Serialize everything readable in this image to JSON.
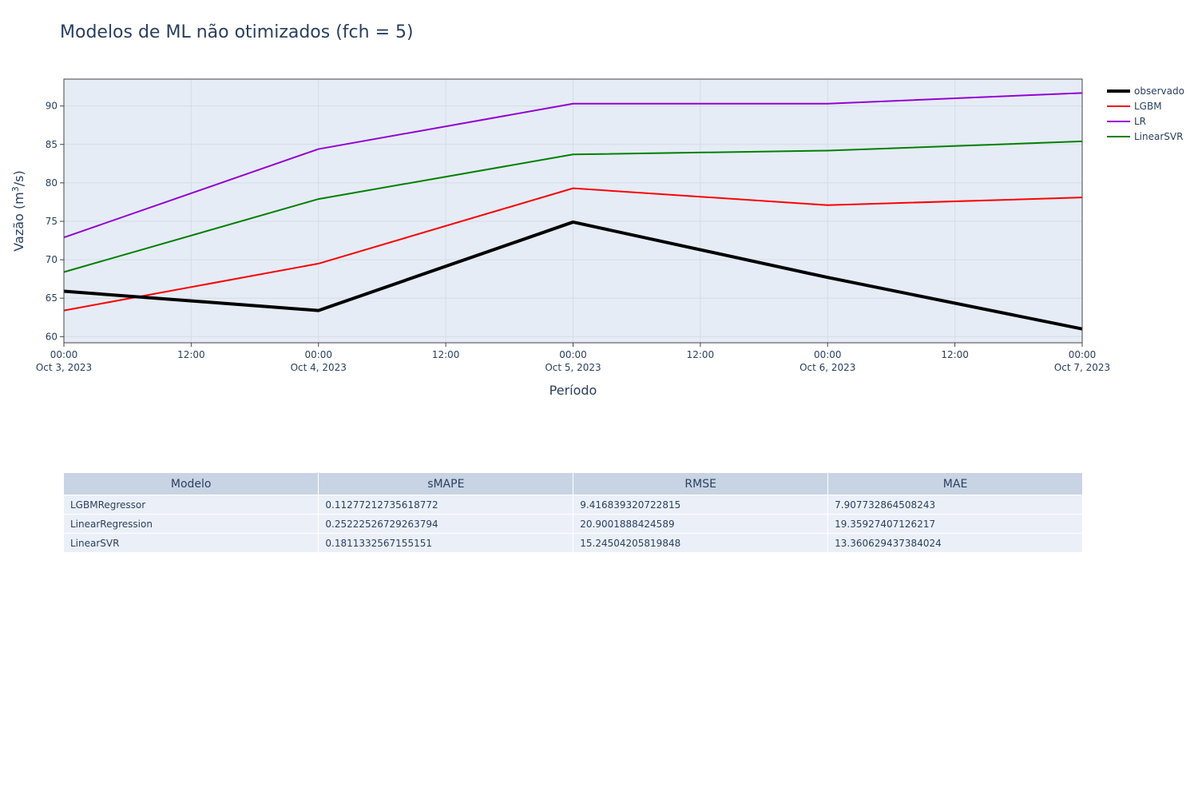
{
  "chart_data": {
    "type": "line",
    "title": "Modelos de ML não otimizados (fch = 5)",
    "xlabel": "Período",
    "ylabel_main": "Vazão (m",
    "ylabel_sup": "3",
    "ylabel_end": "/s)",
    "x": [
      "2023-10-03",
      "2023-10-04",
      "2023-10-05",
      "2023-10-06",
      "2023-10-07"
    ],
    "xlim": [
      "2023-10-03 00:00",
      "2023-10-07 00:00"
    ],
    "ylim": [
      59.2,
      93.5
    ],
    "yticks": [
      60,
      65,
      70,
      75,
      80,
      85,
      90
    ],
    "xtick_labels": [
      {
        "time": "00:00",
        "date": "Oct 3, 2023"
      },
      {
        "time": "12:00",
        "date": ""
      },
      {
        "time": "00:00",
        "date": "Oct 4, 2023"
      },
      {
        "time": "12:00",
        "date": ""
      },
      {
        "time": "00:00",
        "date": "Oct 5, 2023"
      },
      {
        "time": "12:00",
        "date": ""
      },
      {
        "time": "00:00",
        "date": "Oct 6, 2023"
      },
      {
        "time": "12:00",
        "date": ""
      },
      {
        "time": "00:00",
        "date": "Oct 7, 2023"
      }
    ],
    "grid": true,
    "legend_position": "top-right outside",
    "series": [
      {
        "name": "observado",
        "color": "#000000",
        "width": 4,
        "values": [
          65.9,
          63.4,
          74.9,
          67.7,
          61.0
        ]
      },
      {
        "name": "LGBM",
        "color": "#ff0000",
        "width": 2,
        "values": [
          63.4,
          69.5,
          79.3,
          77.1,
          78.1
        ]
      },
      {
        "name": "LR",
        "color": "#9400d3",
        "width": 2,
        "values": [
          72.9,
          84.4,
          90.3,
          90.3,
          91.7
        ]
      },
      {
        "name": "LinearSVR",
        "color": "#008000",
        "width": 2,
        "values": [
          68.4,
          77.9,
          83.7,
          84.2,
          85.4
        ]
      }
    ]
  },
  "table": {
    "headers": [
      "Modelo",
      "sMAPE",
      "RMSE",
      "MAE"
    ],
    "rows": [
      [
        "LGBMRegressor",
        "0.11277212735618772",
        "9.416839320722815",
        "7.907732864508243"
      ],
      [
        "LinearRegression",
        "0.25222526729263794",
        "20.9001888424589",
        "19.35927407126217"
      ],
      [
        "LinearSVR",
        "0.1811332567155151",
        "15.24504205819848",
        "13.360629437384024"
      ]
    ]
  },
  "colors": {
    "plot_background": "#e5ecf6",
    "grid": "#d6dce6",
    "header_background": "#c8d4e3",
    "cell_background": "#ebf0f8"
  }
}
